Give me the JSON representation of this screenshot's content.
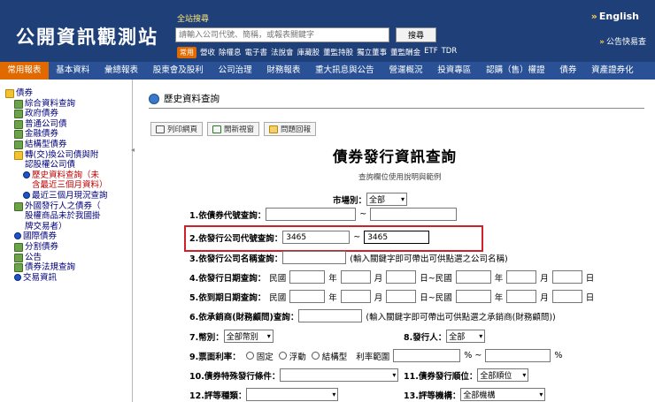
{
  "header": {
    "logo": "公開資訊觀測站",
    "search_title": "全站搜尋",
    "search_placeholder": "請輸入公司代號、簡稱，或報表關鍵字",
    "search_button": "搜尋",
    "common_badge": "常用",
    "common_links": [
      "營收",
      "除權息",
      "電子書",
      "法說會",
      "庫藏股",
      "董監持股",
      "獨立董事",
      "董監酬金",
      "ETF",
      "TDR"
    ],
    "english": "English",
    "announce": "公告快易查"
  },
  "main_menu": [
    "常用報表",
    "基本資料",
    "彙總報表",
    "股東會及股利",
    "公司治理",
    "財務報表",
    "重大訊息與公告",
    "營運概況",
    "投資專區",
    "認購（售）權證",
    "債券",
    "資產證券化"
  ],
  "sidebar": {
    "items": [
      {
        "label": "債券",
        "icon": "folder-icon"
      },
      {
        "label": "綜合資料查詢",
        "icon": "book-icon"
      },
      {
        "label": "政府債券",
        "icon": "book-icon"
      },
      {
        "label": "普通公司債",
        "icon": "book-icon"
      },
      {
        "label": "金融債券",
        "icon": "book-icon"
      },
      {
        "label": "結構型債券",
        "icon": "book-icon"
      },
      {
        "label": "轉(交)換公司債與附",
        "label2": "認股權公司債",
        "icon": "folder-icon"
      },
      {
        "label": "歷史資料查詢（未",
        "label2": "含最近三個月資料）",
        "icon": "dot-icon",
        "sub": true,
        "active": true
      },
      {
        "label": "最近三個月現況查詢",
        "icon": "dot-icon",
        "sub": true
      },
      {
        "label": "外國發行人之債券（",
        "label2": "股權商品未於我國掛",
        "label3": "牌交易者）",
        "icon": "book-icon"
      },
      {
        "label": "國際債券",
        "icon": "dot-icon"
      },
      {
        "label": "分割債券",
        "icon": "book-icon"
      },
      {
        "label": "公告",
        "icon": "book-icon"
      },
      {
        "label": "債券法規查詢",
        "icon": "book-icon"
      },
      {
        "label": "交易資訊",
        "icon": "dot-icon"
      }
    ]
  },
  "content": {
    "page_title": "歷史資料查詢",
    "toolbar": {
      "print": "列印網頁",
      "new_query": "開新視窗",
      "feedback": "問題回報"
    },
    "form_title": "債券發行資訊查詢",
    "form_hint": "查詢欄位使用說明與範例",
    "market_label": "市場別：",
    "market_value": "全部",
    "row1_label": "1.依債券代號查詢：",
    "tilde": "~",
    "row2_label": "2.依發行公司代號查詢：",
    "row2_from": "3465",
    "row2_to": "3465",
    "row3_label": "3.依發行公司名稱查詢：",
    "row3_note": "(輸入關鍵字即可帶出可供點選之公司名稱)",
    "row4_label": "4.依發行日期查詢：",
    "row5_label": "5.依到期日期查詢：",
    "roc": "民國",
    "year": "年",
    "month": "月",
    "day": "日",
    "day_to_roc": "日~民國",
    "row6_label": "6.依承銷商(財務顧問)查詢：",
    "row6_note": "(輸入關鍵字即可帶出可供點選之承銷商(財務顧問))",
    "row7_label": "7.幣別：",
    "row7_value": "全部幣別",
    "row8_label": "8.發行人：",
    "row8_value": "全部",
    "row9_label": "9.票面利率：",
    "row9_fixed": "固定",
    "row9_float": "浮動",
    "row9_struct": "結構型",
    "row9_range": "利率範圍",
    "row9_pct_to": "% ~",
    "row9_pct": "%",
    "row10_label": "10.債券特殊發行條件：",
    "row11_label": "11.債券發行順位：",
    "row11_value": "全部順位",
    "row12_label": "12.評等種類：",
    "row13_label": "13.評等機構：",
    "row13_value": "全部機構"
  },
  "colors": {
    "header": "#1f3f78",
    "menu": "#2a5196",
    "active": "#e06a00",
    "highlight": "#d0202a"
  }
}
